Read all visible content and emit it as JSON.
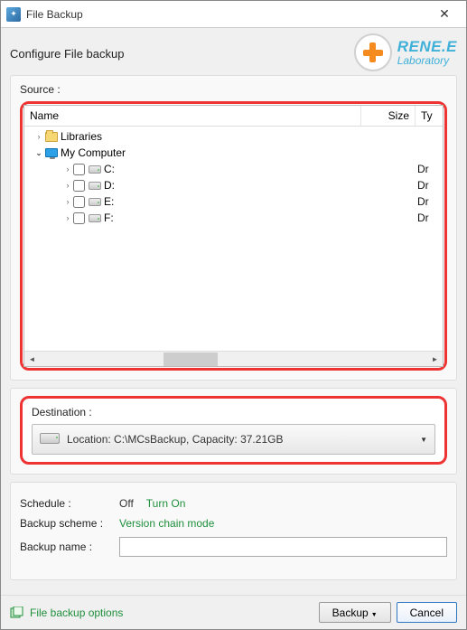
{
  "window": {
    "title": "File Backup"
  },
  "header": {
    "configure_label": "Configure File backup",
    "logo_line1": "RENE.E",
    "logo_line2": "Laboratory"
  },
  "source": {
    "label": "Source :",
    "columns": {
      "name": "Name",
      "size": "Size",
      "type": "Ty"
    },
    "rows": [
      {
        "indent": 0,
        "arrow": "▶",
        "expanded": false,
        "checkbox": false,
        "icon": "folder",
        "label": "Libraries",
        "type": ""
      },
      {
        "indent": 0,
        "arrow": "▼",
        "expanded": true,
        "checkbox": false,
        "icon": "monitor",
        "label": "My Computer",
        "type": ""
      },
      {
        "indent": 1,
        "arrow": "▶",
        "expanded": false,
        "checkbox": true,
        "icon": "drive",
        "label": "C:",
        "type": "Dr"
      },
      {
        "indent": 1,
        "arrow": "▶",
        "expanded": false,
        "checkbox": true,
        "icon": "drive",
        "label": "D:",
        "type": "Dr"
      },
      {
        "indent": 1,
        "arrow": "▶",
        "expanded": false,
        "checkbox": true,
        "icon": "drive",
        "label": "E:",
        "type": "Dr"
      },
      {
        "indent": 1,
        "arrow": "▶",
        "expanded": false,
        "checkbox": true,
        "icon": "drive",
        "label": "F:",
        "type": "Dr"
      }
    ]
  },
  "destination": {
    "label": "Destination :",
    "value": "Location: C:\\MCsBackup, Capacity: 37.21GB"
  },
  "schedule": {
    "label": "Schedule :",
    "status": "Off",
    "action": "Turn On"
  },
  "scheme": {
    "label": "Backup scheme :",
    "value": "Version chain mode"
  },
  "name_row": {
    "label": "Backup name :",
    "value": ""
  },
  "footer": {
    "options_label": "File backup options",
    "backup_btn": "Backup",
    "cancel_btn": "Cancel"
  }
}
